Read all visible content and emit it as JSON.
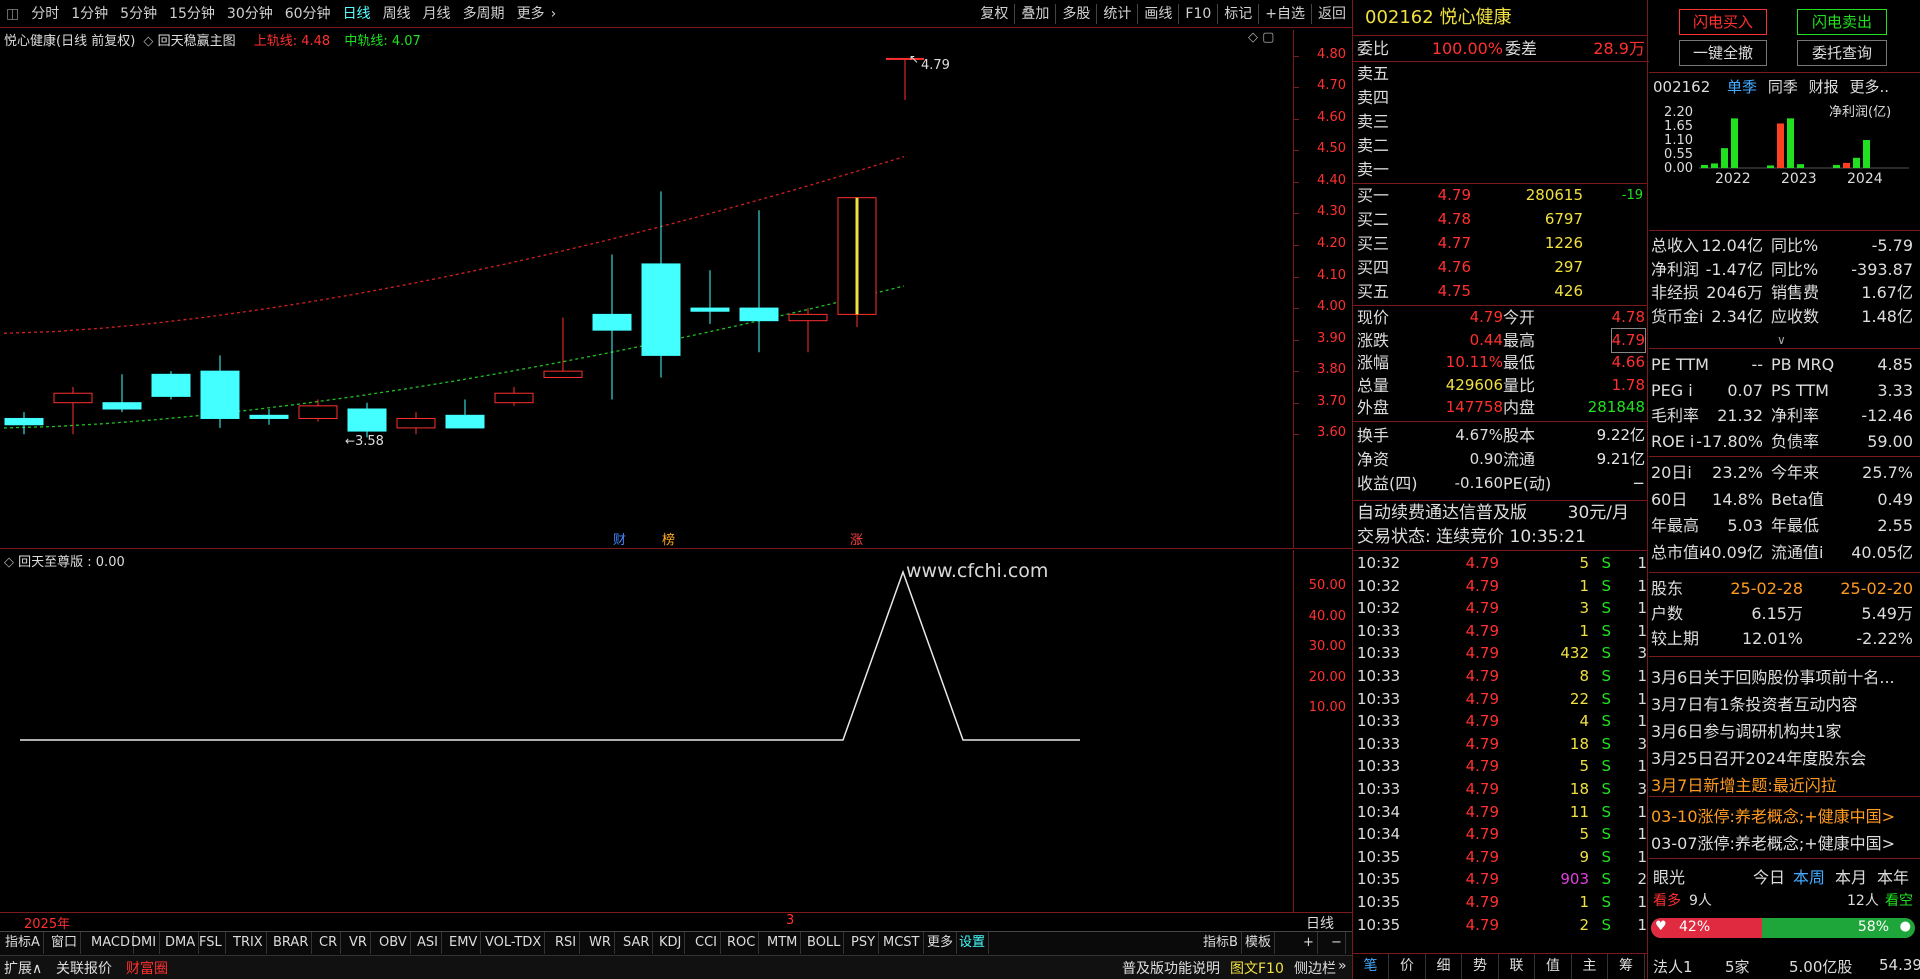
{
  "toolbar": {
    "left": [
      "分时",
      "1分钟",
      "5分钟",
      "15分钟",
      "30分钟",
      "60分钟",
      "日线",
      "周线",
      "月线",
      "多周期",
      "更多"
    ],
    "right": [
      "复权",
      "叠加",
      "多股",
      "统计",
      "画线",
      "F10",
      "标记",
      "+自选",
      "返回"
    ]
  },
  "chart": {
    "title": "悦心健康(日线 前复权)",
    "indicator": "回天稳赢主图",
    "upper_label": "上轨线: 4.48",
    "mid_label": "中轨线: 4.07",
    "high_mark": "4.79",
    "low_mark": "3.58",
    "y_ticks": [
      "4.80",
      "4.70",
      "4.60",
      "4.50",
      "4.40",
      "4.30",
      "4.20",
      "4.10",
      "4.00",
      "3.90",
      "3.80",
      "3.70",
      "3.60"
    ],
    "badges": [
      "财",
      "榜",
      "涨"
    ]
  },
  "chart_data": {
    "type": "candlestick",
    "x": [
      "d1",
      "d2",
      "d3",
      "d4",
      "d5",
      "d6",
      "d7",
      "d8",
      "d9",
      "d10",
      "d11",
      "d12",
      "d13",
      "d14",
      "d15",
      "d16",
      "d17",
      "d18"
    ],
    "open": [
      3.65,
      3.7,
      3.7,
      3.79,
      3.8,
      3.66,
      3.65,
      3.68,
      3.62,
      3.66,
      3.7,
      3.78,
      3.98,
      4.14,
      4.0,
      4.0,
      3.96,
      3.98
    ],
    "high": [
      3.67,
      3.75,
      3.79,
      3.8,
      3.85,
      3.68,
      3.71,
      3.7,
      3.67,
      3.71,
      3.75,
      3.97,
      4.17,
      4.37,
      4.12,
      4.31,
      4.0,
      4.35
    ],
    "low": [
      3.6,
      3.6,
      3.67,
      3.71,
      3.62,
      3.63,
      3.64,
      3.59,
      3.6,
      3.63,
      3.69,
      3.78,
      3.71,
      3.78,
      3.95,
      3.86,
      3.86,
      3.94
    ],
    "close": [
      3.63,
      3.73,
      3.68,
      3.72,
      3.65,
      3.65,
      3.69,
      3.61,
      3.65,
      3.62,
      3.73,
      3.8,
      3.93,
      3.85,
      3.99,
      3.96,
      3.98,
      4.35
    ],
    "last": {
      "open": 4.79,
      "high": 4.79,
      "low": 4.66,
      "close": 4.79
    },
    "ylim": [
      3.55,
      4.85
    ]
  },
  "sub": {
    "title": "回天至尊版 : 0.00",
    "watermark": "www.cfchi.com",
    "y_ticks": [
      "50.00",
      "40.00",
      "30.00",
      "20.00",
      "10.00"
    ],
    "x_labels": [
      "2025年",
      "3"
    ],
    "corner": "日线",
    "peak": 55
  },
  "indicator_tabs": [
    "指标A",
    "窗口",
    "MACD",
    "DMI",
    "DMA",
    "FSL",
    "TRIX",
    "BRAR",
    "CR",
    "VR",
    "OBV",
    "ASI",
    "EMV",
    "VOL-TDX",
    "RSI",
    "WR",
    "SAR",
    "KDJ",
    "CCI",
    "ROC",
    "MTM",
    "BOLL",
    "PSY",
    "MCST",
    "更多",
    "设置"
  ],
  "indicator_right": [
    "指标B",
    "模板",
    "+",
    "−"
  ],
  "bottom_tabs": [
    "扩展∧",
    "关联报价",
    "财富圈"
  ],
  "bottom_right": [
    "普及版功能说明",
    "图文F10",
    "侧边栏"
  ],
  "quote": {
    "code": "002162",
    "name": "悦心健康",
    "weibi_label": "委比",
    "weibi": "100.00%",
    "weicha_label": "委差",
    "weicha": "28.9万",
    "sells": [
      "卖五",
      "卖四",
      "卖三",
      "卖二",
      "卖一"
    ],
    "buys": [
      {
        "l": "买一",
        "p": "4.79",
        "v": "280615",
        "c": "-19"
      },
      {
        "l": "买二",
        "p": "4.78",
        "v": "6797",
        "c": ""
      },
      {
        "l": "买三",
        "p": "4.77",
        "v": "1226",
        "c": ""
      },
      {
        "l": "买四",
        "p": "4.76",
        "v": "297",
        "c": ""
      },
      {
        "l": "买五",
        "p": "4.75",
        "v": "426",
        "c": ""
      }
    ],
    "stats": [
      [
        "现价",
        "4.79",
        "今开",
        "4.78"
      ],
      [
        "涨跌",
        "0.44",
        "最高",
        "4.79"
      ],
      [
        "涨幅",
        "10.11%",
        "最低",
        "4.66"
      ],
      [
        "总量",
        "429606",
        "量比",
        "1.78"
      ],
      [
        "外盘",
        "147758",
        "内盘",
        "281848"
      ]
    ],
    "stats2": [
      [
        "换手",
        "4.67%",
        "股本",
        "9.22亿"
      ],
      [
        "净资",
        "0.90",
        "流通",
        "9.21亿"
      ],
      [
        "收益(四)",
        "-0.160",
        "PE(动)",
        "−"
      ]
    ],
    "ad": "自动续费通达信普及版",
    "ad_price": "30元/月",
    "status": "交易状态: 连续竞价 10:35:21"
  },
  "ticks": [
    [
      "10:32",
      "4.79",
      "5",
      "S",
      "1"
    ],
    [
      "10:32",
      "4.79",
      "1",
      "S",
      "1"
    ],
    [
      "10:32",
      "4.79",
      "3",
      "S",
      "1"
    ],
    [
      "10:33",
      "4.79",
      "1",
      "S",
      "1"
    ],
    [
      "10:33",
      "4.79",
      "432",
      "S",
      "3"
    ],
    [
      "10:33",
      "4.79",
      "8",
      "S",
      "1"
    ],
    [
      "10:33",
      "4.79",
      "22",
      "S",
      "1"
    ],
    [
      "10:33",
      "4.79",
      "4",
      "S",
      "1"
    ],
    [
      "10:33",
      "4.79",
      "18",
      "S",
      "3"
    ],
    [
      "10:33",
      "4.79",
      "5",
      "S",
      "1"
    ],
    [
      "10:33",
      "4.79",
      "18",
      "S",
      "3"
    ],
    [
      "10:34",
      "4.79",
      "11",
      "S",
      "1"
    ],
    [
      "10:34",
      "4.79",
      "5",
      "S",
      "1"
    ],
    [
      "10:35",
      "4.79",
      "9",
      "S",
      "1"
    ],
    [
      "10:35",
      "4.79",
      "903",
      "S",
      "2"
    ],
    [
      "10:35",
      "4.79",
      "1",
      "S",
      "1"
    ],
    [
      "10:35",
      "4.79",
      "2",
      "S",
      "1"
    ]
  ],
  "tick_tabs": [
    "笔",
    "价",
    "细",
    "势",
    "联",
    "值",
    "主",
    "筹"
  ],
  "fin": {
    "buy_btn": "闪电买入",
    "sell_btn": "闪电卖出",
    "cancel_btn": "一键全撤",
    "query_btn": "委托查询",
    "code": "002162",
    "tabs": [
      "单季",
      "同季",
      "财报",
      "更多.."
    ],
    "chart_title": "净利润(亿)",
    "y_ticks": [
      "2.20",
      "1.65",
      "1.10",
      "0.55",
      "0.00"
    ],
    "years": [
      "2022",
      "2023",
      "2024"
    ],
    "bars": [
      {
        "v": 0.12,
        "c": "#20e020"
      },
      {
        "v": 0.18,
        "c": "#20e020"
      },
      {
        "v": 0.78,
        "c": "#20e020"
      },
      {
        "v": 1.95,
        "c": "#20e020"
      },
      {
        "v": 0.1,
        "c": "#20e020"
      },
      {
        "v": 1.75,
        "c": "#ff4020"
      },
      {
        "v": 1.95,
        "c": "#20e020"
      },
      {
        "v": 0.15,
        "c": "#20e020"
      },
      {
        "v": 0.12,
        "c": "#20e020"
      },
      {
        "v": 0.2,
        "c": "#ff4020"
      },
      {
        "v": 0.4,
        "c": "#20e020"
      },
      {
        "v": 1.1,
        "c": "#20e020"
      }
    ],
    "rows": [
      [
        "总收入",
        "12.04亿",
        "同比%",
        "-5.79"
      ],
      [
        "净利润",
        "-1.47亿",
        "同比%",
        "-393.87"
      ],
      [
        "非经损",
        "2046万",
        "销售费",
        "1.67亿"
      ],
      [
        "货币金i",
        "2.34亿",
        "应收数",
        "1.48亿"
      ]
    ],
    "rows2": [
      [
        "PE TTM",
        "--",
        "PB MRQ",
        "4.85"
      ],
      [
        "PEG i",
        "0.07",
        "PS TTM",
        "3.33"
      ],
      [
        "毛利率",
        "21.32",
        "净利率",
        "-12.46"
      ],
      [
        "ROE i",
        "-17.80%",
        "负债率",
        "59.00"
      ]
    ],
    "rows3": [
      [
        "20日i",
        "23.2%",
        "今年来",
        "25.7%"
      ],
      [
        "60日",
        "14.8%",
        "Beta值",
        "0.49"
      ],
      [
        "年最高",
        "5.03",
        "年最低",
        "2.55"
      ],
      [
        "总市值i",
        "40.09亿",
        "流通值i",
        "40.05亿"
      ]
    ],
    "holder": {
      "label": "股东",
      "d1": "25-02-28",
      "d2": "25-02-20",
      "hu": "户数",
      "h1": "6.15万",
      "h2": "5.49万",
      "jq": "较上期",
      "j1": "12.01%",
      "j2": "-2.22%"
    },
    "news": [
      "3月6日关于回购股份事项前十名...",
      "3月7日有1条投资者互动内容",
      "3月6日参与调研机构共1家",
      "3月25日召开2024年度股东会",
      "3月7日新增主题:最近闪拉"
    ],
    "limits": [
      "03-10涨停:养老概念;+健康中国>",
      "03-07涨停:养老概念;+健康中国>"
    ],
    "eye": {
      "label": "眼光",
      "tabs": [
        "今日",
        "本周",
        "本月",
        "本年"
      ],
      "bull": "看多",
      "bull_n": "9人",
      "bear_n": "12人",
      "bear": "看空",
      "bull_pct": "42%",
      "bear_pct": "58%"
    },
    "last_row": [
      "法人1",
      "5家",
      "5.00亿股",
      "54.39"
    ]
  }
}
